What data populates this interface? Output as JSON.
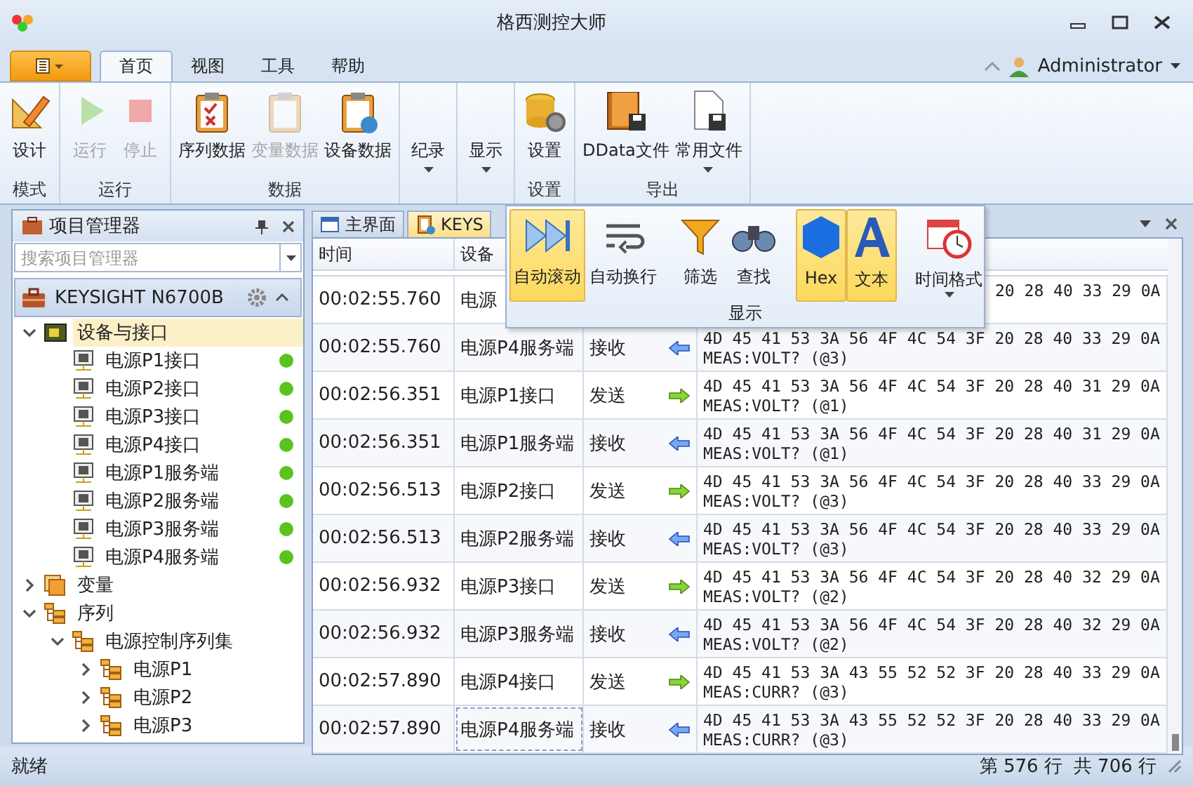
{
  "window": {
    "title": "格西测控大师"
  },
  "ribbon_tabs": [
    {
      "label": "首页",
      "selected": true
    },
    {
      "label": "视图",
      "selected": false
    },
    {
      "label": "工具",
      "selected": false
    },
    {
      "label": "帮助",
      "selected": false
    }
  ],
  "user": {
    "name": "Administrator"
  },
  "ribbon_groups": [
    {
      "label": "模式",
      "buttons": [
        {
          "label": "设计",
          "disabled": false
        }
      ]
    },
    {
      "label": "运行",
      "buttons": [
        {
          "label": "运行",
          "disabled": true
        },
        {
          "label": "停止",
          "disabled": true
        }
      ]
    },
    {
      "label": "数据",
      "buttons": [
        {
          "label": "序列数据",
          "disabled": false
        },
        {
          "label": "变量数据",
          "disabled": true
        },
        {
          "label": "设备数据",
          "disabled": false
        }
      ]
    },
    {
      "buttons": [
        {
          "label": "纪录",
          "disabled": false,
          "dropdown": true
        }
      ]
    },
    {
      "buttons": [
        {
          "label": "显示",
          "disabled": false,
          "dropdown": true
        }
      ]
    },
    {
      "label": "设置",
      "buttons": [
        {
          "label": "设置",
          "disabled": false
        }
      ]
    },
    {
      "label": "导出",
      "buttons": [
        {
          "label": "DData文件",
          "disabled": false
        },
        {
          "label": "常用文件",
          "disabled": false,
          "dropdown": true
        }
      ]
    }
  ],
  "project_panel": {
    "title": "项目管理器",
    "search": {
      "placeholder": "搜索项目管理器"
    },
    "device": "KEYSIGHT N6700B",
    "tree": [
      {
        "label": "设备与接口",
        "kind": "device",
        "expanded": true,
        "selected": true,
        "children": [
          {
            "label": "电源P1接口",
            "kind": "port",
            "online": true
          },
          {
            "label": "电源P2接口",
            "kind": "port",
            "online": true
          },
          {
            "label": "电源P3接口",
            "kind": "port",
            "online": true
          },
          {
            "label": "电源P4接口",
            "kind": "port",
            "online": true
          },
          {
            "label": "电源P1服务端",
            "kind": "port",
            "online": true
          },
          {
            "label": "电源P2服务端",
            "kind": "port",
            "online": true
          },
          {
            "label": "电源P3服务端",
            "kind": "port",
            "online": true
          },
          {
            "label": "电源P4服务端",
            "kind": "port",
            "online": true
          }
        ]
      },
      {
        "label": "变量",
        "kind": "variables",
        "expanded": false,
        "selected": false
      },
      {
        "label": "序列",
        "kind": "sequence",
        "expanded": true,
        "selected": false,
        "children": [
          {
            "label": "电源控制序列集",
            "kind": "sequence",
            "expanded": true,
            "selected": false,
            "children": [
              {
                "label": "电源P1",
                "kind": "sequence",
                "expanded": false,
                "selected": false
              },
              {
                "label": "电源P2",
                "kind": "sequence",
                "expanded": false,
                "selected": false
              },
              {
                "label": "电源P3",
                "kind": "sequence",
                "expanded": false,
                "selected": false
              }
            ]
          }
        ]
      }
    ]
  },
  "doc_tabs": [
    {
      "label": "主界面",
      "selected": false
    },
    {
      "label": "KEYS",
      "selected": true
    }
  ],
  "display_popup": {
    "label": "显示",
    "buttons": [
      {
        "label": "自动滚动",
        "selected": true
      },
      {
        "label": "自动换行",
        "selected": false
      },
      {
        "label": "筛选",
        "selected": false
      },
      {
        "label": "查找",
        "selected": false
      },
      {
        "label": "Hex",
        "selected": true
      },
      {
        "label": "文本",
        "selected": true
      },
      {
        "label": "时间格式",
        "selected": false,
        "dropdown": true
      }
    ]
  },
  "table": {
    "columns": [
      "时间",
      "设备"
    ],
    "rows": [
      {
        "time": "00:02:55.760",
        "device": "电源",
        "hex": "20 28 40 33 29 0A",
        "clipped": true
      },
      {
        "time": "00:02:55.760",
        "device": "电源P4服务端",
        "direction": "接收",
        "kind": "receive",
        "hex": "4D 45 41 53 3A 56 4F 4C 54 3F 20 28 40 33 29 0A",
        "text": "MEAS:VOLT? (@3)"
      },
      {
        "time": "00:02:56.351",
        "device": "电源P1接口",
        "direction": "发送",
        "kind": "send",
        "hex": "4D 45 41 53 3A 56 4F 4C 54 3F 20 28 40 31 29 0A",
        "text": "MEAS:VOLT? (@1)"
      },
      {
        "time": "00:02:56.351",
        "device": "电源P1服务端",
        "direction": "接收",
        "kind": "receive",
        "hex": "4D 45 41 53 3A 56 4F 4C 54 3F 20 28 40 31 29 0A",
        "text": "MEAS:VOLT? (@1)"
      },
      {
        "time": "00:02:56.513",
        "device": "电源P2接口",
        "direction": "发送",
        "kind": "send",
        "hex": "4D 45 41 53 3A 56 4F 4C 54 3F 20 28 40 33 29 0A",
        "text": "MEAS:VOLT? (@3)"
      },
      {
        "time": "00:02:56.513",
        "device": "电源P2服务端",
        "direction": "接收",
        "kind": "receive",
        "hex": "4D 45 41 53 3A 56 4F 4C 54 3F 20 28 40 33 29 0A",
        "text": "MEAS:VOLT? (@3)"
      },
      {
        "time": "00:02:56.932",
        "device": "电源P3接口",
        "direction": "发送",
        "kind": "send",
        "hex": "4D 45 41 53 3A 56 4F 4C 54 3F 20 28 40 32 29 0A",
        "text": "MEAS:VOLT? (@2)"
      },
      {
        "time": "00:02:56.932",
        "device": "电源P3服务端",
        "direction": "接收",
        "kind": "receive",
        "hex": "4D 45 41 53 3A 56 4F 4C 54 3F 20 28 40 32 29 0A",
        "text": "MEAS:VOLT? (@2)"
      },
      {
        "time": "00:02:57.890",
        "device": "电源P4接口",
        "direction": "发送",
        "kind": "send",
        "hex": "4D 45 41 53 3A 43 55 52 52 3F 20 28 40 33 29 0A",
        "text": "MEAS:CURR? (@3)"
      },
      {
        "time": "00:02:57.890",
        "device": "电源P4服务端",
        "direction": "接收",
        "kind": "receive",
        "hex": "4D 45 41 53 3A 43 55 52 52 3F 20 28 40 33 29 0A",
        "text": "MEAS:CURR? (@3)",
        "focused": true
      }
    ]
  },
  "status_bar": {
    "text": "就绪",
    "line": "第 576 行",
    "total": "共 706 行"
  }
}
